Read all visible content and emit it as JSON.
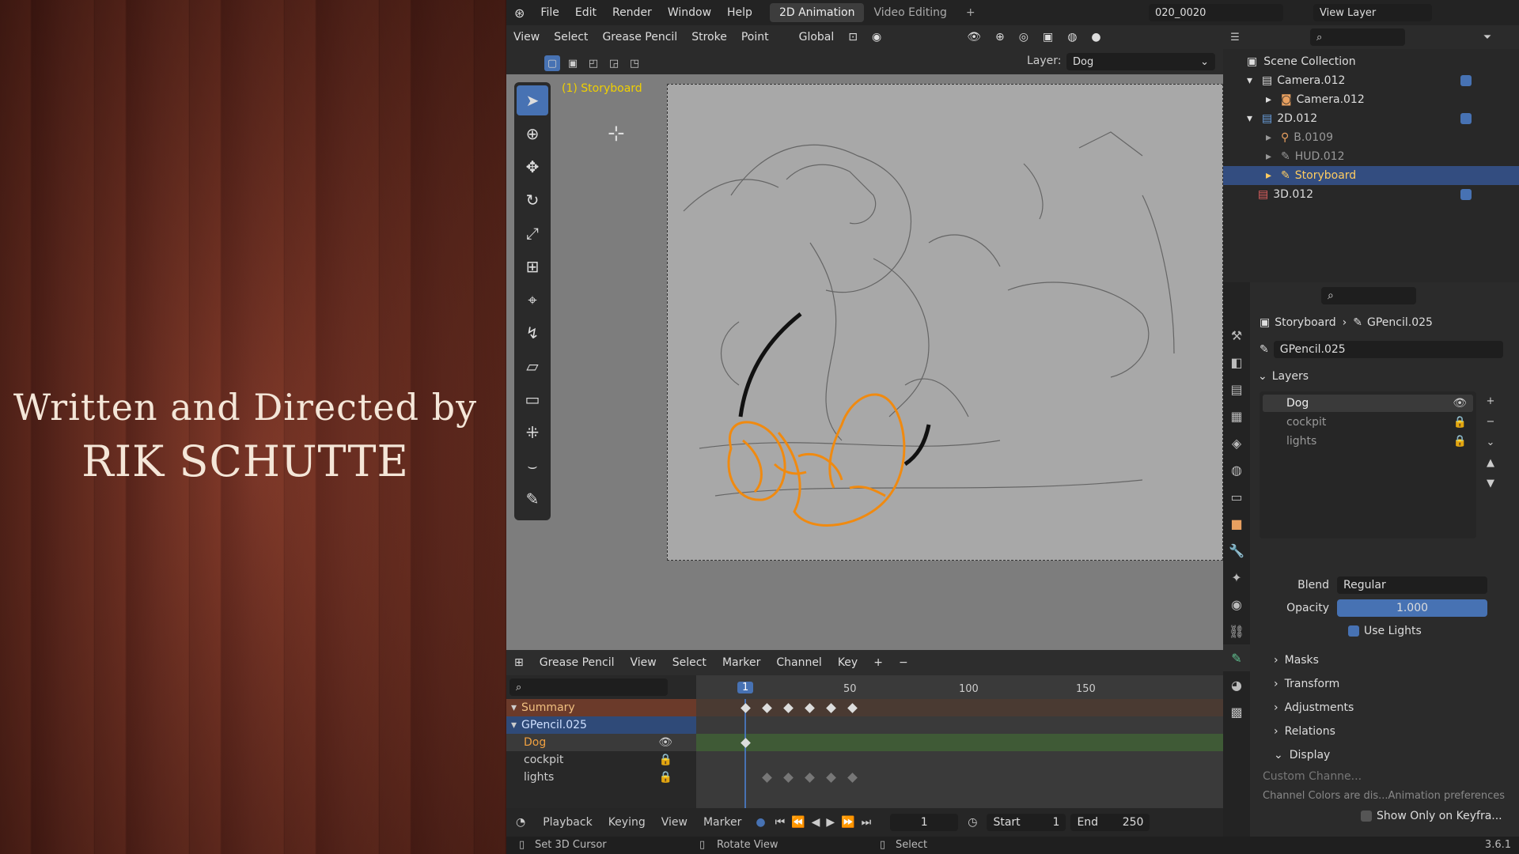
{
  "credits": {
    "line1": "Written and Directed by",
    "line2": "RIK SCHUTTE"
  },
  "topbar": {
    "menus": [
      "File",
      "Edit",
      "Render",
      "Window",
      "Help"
    ],
    "workspaces": [
      "2D Animation",
      "Video Editing"
    ],
    "scene_name": "020_0020",
    "view_layer": "View Layer"
  },
  "viewport_header": {
    "menus": [
      "View",
      "Select",
      "Grease Pencil",
      "Stroke",
      "Point"
    ],
    "orientation": "Global",
    "layer_label": "Layer:",
    "layer_value": "Dog",
    "overlay_text": "(1) Storyboard"
  },
  "timeline": {
    "editor": "Grease Pencil",
    "menus": [
      "View",
      "Select",
      "Marker",
      "Channel",
      "Key"
    ],
    "frame_ticks": [
      "1",
      "50",
      "100",
      "150"
    ],
    "current_frame": "1",
    "channels": [
      {
        "name": "Summary",
        "color": "#e0a060"
      },
      {
        "name": "GPencil.025",
        "color": "#9ab8e8"
      },
      {
        "name": "Dog",
        "color": "#f0a040"
      },
      {
        "name": "cockpit",
        "color": "#cccccc"
      },
      {
        "name": "lights",
        "color": "#cccccc"
      }
    ]
  },
  "playback": {
    "menus": [
      "Playback",
      "Keying",
      "View",
      "Marker"
    ],
    "frame": "1",
    "start_label": "Start",
    "start": "1",
    "end_label": "End",
    "end": "250"
  },
  "status": {
    "left": "Set 3D Cursor",
    "middle": "Rotate View",
    "right": "Select",
    "version": "3.6.1"
  },
  "outliner": {
    "title": "Scene Collection",
    "rows": [
      {
        "name": "Camera.012",
        "indent": 1,
        "icon": "collection-icon"
      },
      {
        "name": "Camera.012",
        "indent": 2,
        "icon": "camera-icon"
      },
      {
        "name": "2D.012",
        "indent": 1,
        "icon": "collection-icon"
      },
      {
        "name": "B.0109",
        "indent": 2,
        "icon": "armature-icon"
      },
      {
        "name": "HUD.012",
        "indent": 2,
        "icon": "gpencil-icon"
      },
      {
        "name": "Storyboard",
        "indent": 2,
        "icon": "gpencil-icon",
        "selected": true
      },
      {
        "name": "3D.012",
        "indent": 1,
        "icon": "collection-icon"
      }
    ]
  },
  "properties": {
    "breadcrumb_object": "Storyboard",
    "breadcrumb_data": "GPencil.025",
    "datablock": "GPencil.025",
    "layers_title": "Layers",
    "layers": [
      "Dog",
      "cockpit",
      "lights"
    ],
    "blend_label": "Blend",
    "blend_value": "Regular",
    "opacity_label": "Opacity",
    "opacity_value": "1.000",
    "use_lights_label": "Use Lights",
    "sections": [
      "Masks",
      "Transform",
      "Adjustments",
      "Relations",
      "Display"
    ],
    "custom_channel": "Custom Channe...",
    "channel_note": "Channel Colors are dis...Animation preferences",
    "show_only_keyframes": "Show Only on Keyfra..."
  },
  "colors": {
    "accent": "#4772b3",
    "orange_stroke": "#f08a10",
    "selected_row": "#334d80"
  }
}
